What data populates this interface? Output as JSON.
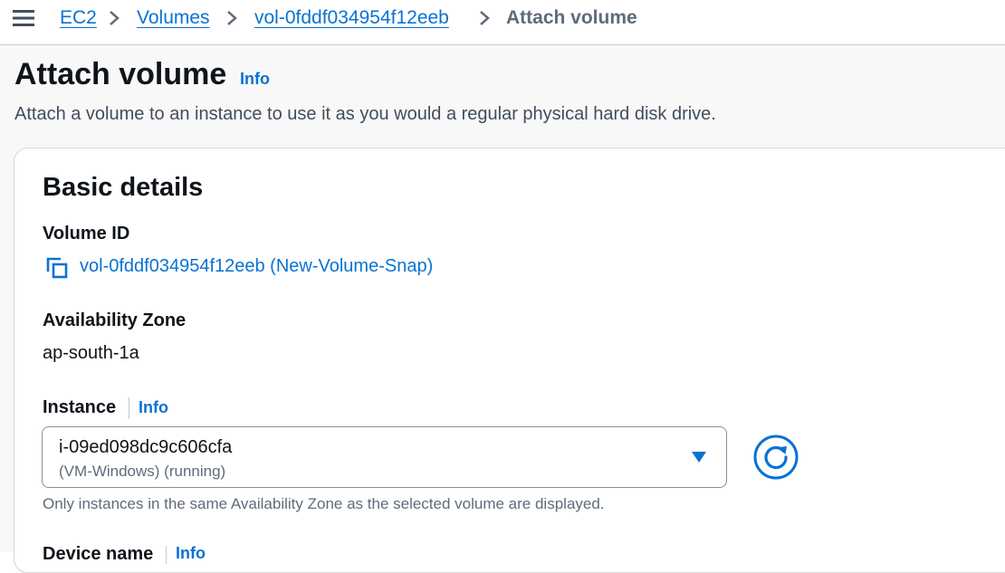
{
  "breadcrumb": {
    "items": [
      {
        "label": "EC2"
      },
      {
        "label": "Volumes"
      },
      {
        "label": "vol-0fddf034954f12eeb"
      }
    ],
    "current": "Attach volume"
  },
  "page": {
    "title": "Attach volume",
    "info_label": "Info",
    "description": "Attach a volume to an instance to use it as you would a regular physical hard disk drive."
  },
  "basic_details": {
    "title": "Basic details",
    "volume_id": {
      "label": "Volume ID",
      "value": "vol-0fddf034954f12eeb (New-Volume-Snap)"
    },
    "availability_zone": {
      "label": "Availability Zone",
      "value": "ap-south-1a"
    },
    "instance": {
      "label": "Instance",
      "info_label": "Info",
      "selected_value": "i-09ed098dc9c606cfa",
      "selected_description": "(VM-Windows) (running)",
      "constraint": "Only instances in the same Availability Zone as the selected volume are displayed."
    },
    "device_name": {
      "label": "Device name",
      "info_label": "Info"
    }
  },
  "icons": {
    "menu": "menu-icon",
    "chevron": "chevron-right-icon",
    "copy": "copy-icon",
    "caret": "caret-down-icon",
    "refresh": "refresh-icon"
  },
  "colors": {
    "link": "#0972d3",
    "text": "#0f141a",
    "muted": "#5f6b7a",
    "border": "#8c8c94",
    "background": "#f8f8f8"
  }
}
